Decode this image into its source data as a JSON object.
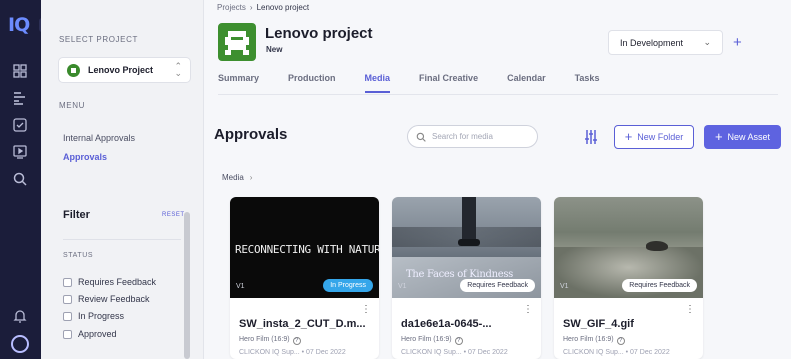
{
  "rail": {
    "logo": "IQ",
    "toggle": "›",
    "icons": [
      "grid-icon",
      "timeline-icon",
      "checkbox-icon",
      "play-screen-icon",
      "search-icon",
      "bell-icon",
      "user-avatar-icon"
    ]
  },
  "sidebar": {
    "select_project_label": "SELECT PROJECT",
    "project_name": "Lenovo Project",
    "menu_label": "MENU",
    "menu_items": [
      {
        "label": "Internal Approvals",
        "active": false
      },
      {
        "label": "Approvals",
        "active": true
      }
    ],
    "filter": {
      "title": "Filter",
      "reset": "RESET",
      "status_label": "STATUS",
      "options": [
        "Requires Feedback",
        "Review Feedback",
        "In Progress",
        "Approved"
      ]
    }
  },
  "header": {
    "breadcrumb": [
      "Projects",
      "Lenovo project"
    ],
    "breadcrumb_sep": "›",
    "title": "Lenovo project",
    "subtitle": "New",
    "status": "In Development",
    "plus": "+",
    "tabs": [
      {
        "label": "Summary",
        "active": false
      },
      {
        "label": "Production",
        "active": false
      },
      {
        "label": "Media",
        "active": true
      },
      {
        "label": "Final Creative",
        "active": false
      },
      {
        "label": "Calendar",
        "active": false
      },
      {
        "label": "Tasks",
        "active": false
      }
    ]
  },
  "approvals": {
    "title": "Approvals",
    "search_placeholder": "Search for media",
    "new_folder": "New Folder",
    "new_asset": "New Asset",
    "btn_plus": "+",
    "media_crumb": "Media",
    "media_crumb_arrow": "›"
  },
  "cards": [
    {
      "thumb_text": "RECONNECTING WITH NATURE",
      "version": "V1",
      "badge": "In Progress",
      "title": "SW_insta_2_CUT_D.m...",
      "format": "Hero Film (16:9)",
      "help": "?",
      "meta": "CLICKON IQ Sup... • 07 Dec 2022"
    },
    {
      "thumb_text": "The Faces of Kindness",
      "version": "V1",
      "badge": "Requires Feedback",
      "title": "da1e6e1a-0645-...",
      "format": "Hero Film (16:9)",
      "help": "?",
      "meta": "CLICKON IQ Sup... • 07 Dec 2022"
    },
    {
      "thumb_text": "",
      "version": "V1",
      "badge": "Requires Feedback",
      "title": "SW_GIF_4.gif",
      "format": "Hero Film (16:9)",
      "help": "?",
      "meta": "CLICKON IQ Sup... • 07 Dec 2022"
    }
  ],
  "kebab": "⋮",
  "colors": {
    "rail": "#1b1d3a",
    "accent": "#5a5fd6",
    "in_progress": "#35a6ea",
    "project_green": "#3d8f2f"
  }
}
